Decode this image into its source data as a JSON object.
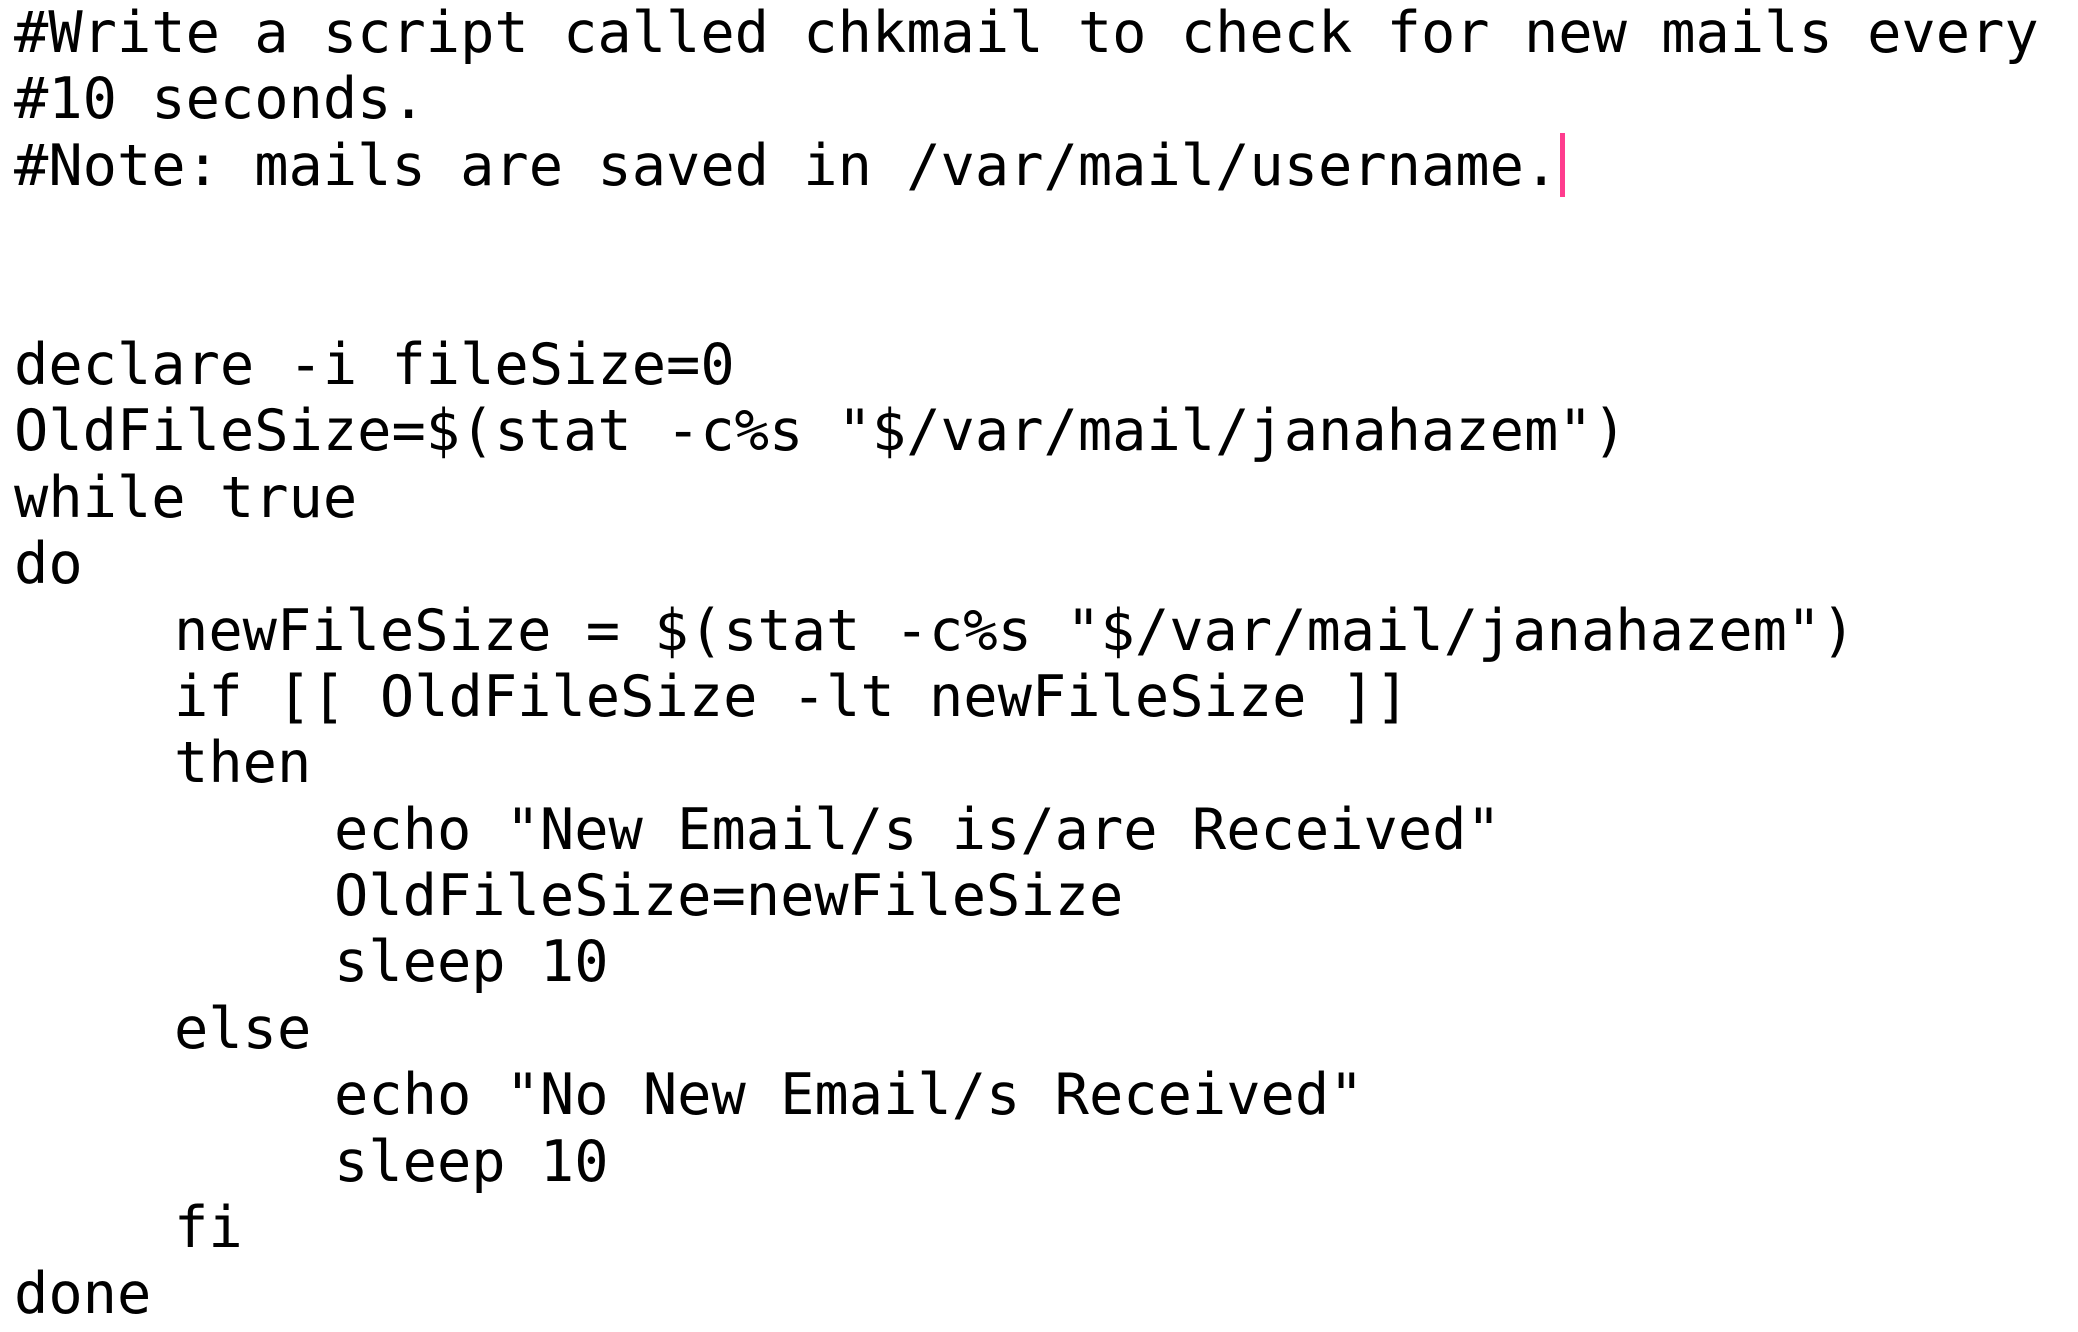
{
  "editor": {
    "cursor_color": "#ff3c8e",
    "lines": [
      "#Write a script called chkmail to check for new mails every",
      "#10 seconds.",
      "#Note: mails are saved in /var/mail/username.",
      "",
      "",
      "declare -i fileSize=0",
      "OldFileSize=$(stat -c%s \"$/var/mail/janahazem\")",
      "while true",
      "do",
      "newFileSize = $(stat -c%s \"$/var/mail/janahazem\")",
      "if [[ OldFileSize -lt newFileSize ]]",
      "then",
      "echo \"New Email/s is/are Received\"",
      "OldFileSize=newFileSize",
      "sleep 10",
      "else",
      "echo \"No New Email/s Received\"",
      "sleep 10",
      "fi",
      "done"
    ]
  }
}
